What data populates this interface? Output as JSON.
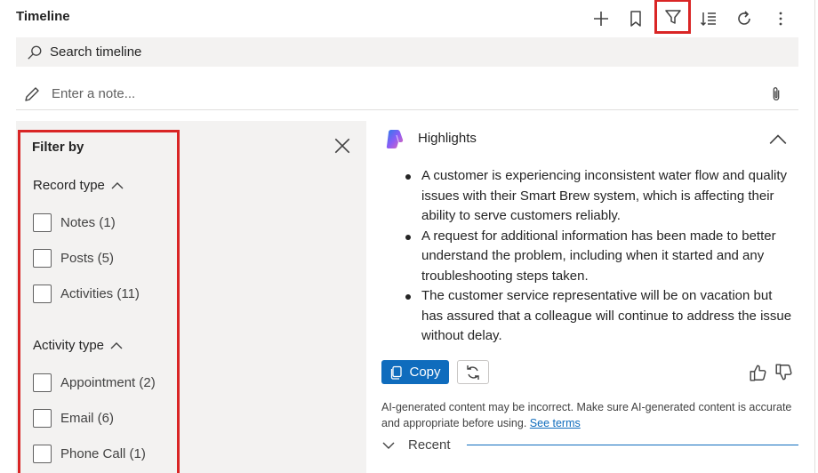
{
  "header": {
    "title": "Timeline"
  },
  "toolbar": {
    "icons": [
      "add-icon",
      "bookmark-icon",
      "filter-icon",
      "sort-icon",
      "refresh-icon",
      "more-icon"
    ],
    "highlight_color": "#d92525"
  },
  "search": {
    "placeholder": "Search timeline"
  },
  "note": {
    "placeholder": "Enter a note..."
  },
  "filter": {
    "title": "Filter by",
    "record_type": {
      "label": "Record type",
      "options": [
        {
          "label": "Notes (1)",
          "checked": false
        },
        {
          "label": "Posts (5)",
          "checked": false
        },
        {
          "label": "Activities (11)",
          "checked": false
        }
      ]
    },
    "activity_type": {
      "label": "Activity type",
      "options": [
        {
          "label": "Appointment (2)",
          "checked": false
        },
        {
          "label": "Email (6)",
          "checked": false
        },
        {
          "label": "Phone Call (1)",
          "checked": false
        }
      ]
    }
  },
  "highlights": {
    "title": "Highlights",
    "bullets": [
      "A customer is experiencing inconsistent water flow and quality issues with their Smart Brew system, which is affecting their ability to serve customers reliably.",
      "A request for additional information has been made to better understand the problem, including when it started and any troubleshooting steps taken.",
      "The customer service representative will be on vacation but has assured that a colleague will continue to address the issue without delay."
    ],
    "copy_label": "Copy",
    "disclaimer": "AI-generated content may be incorrect. Make sure AI-generated content is accurate and appropriate before using.",
    "see_terms": "See terms"
  },
  "recent": {
    "label": "Recent"
  },
  "colors": {
    "accent": "#0f6cbd",
    "panel_bg": "#f3f2f1"
  }
}
